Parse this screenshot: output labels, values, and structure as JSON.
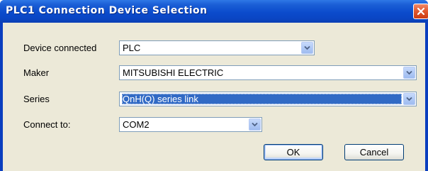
{
  "window": {
    "title": "PLC1 Connection Device Selection",
    "close_icon": "close-icon"
  },
  "form": {
    "device_connected": {
      "label": "Device connected",
      "value": "PLC"
    },
    "maker": {
      "label": "Maker",
      "value": "MITSUBISHI ELECTRIC"
    },
    "series": {
      "label": "Series",
      "value": "QnH(Q) series link"
    },
    "connect_to": {
      "label": "Connect to:",
      "value": "COM2"
    }
  },
  "buttons": {
    "ok": "OK",
    "cancel": "Cancel"
  },
  "colors": {
    "title_bar": "#0b4bcc",
    "dialog_bg": "#ece9d8",
    "selection": "#316ac5",
    "close_button": "#e25a30"
  }
}
